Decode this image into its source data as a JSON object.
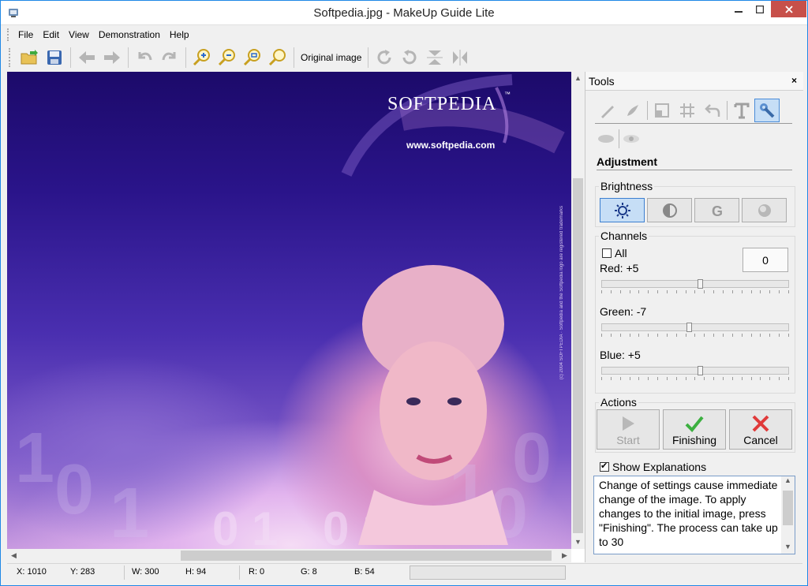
{
  "window": {
    "title": "Softpedia.jpg - MakeUp Guide Lite"
  },
  "menu": [
    "File",
    "Edit",
    "View",
    "Demonstration",
    "Help"
  ],
  "toolbar": {
    "original_image_label": "Original image"
  },
  "image": {
    "logo_text": "SOFTPEDIA",
    "logo_tm": "™",
    "url_text": "www.softpedia.com",
    "side_text": "(c) 2004 SOFTPEDIA · Softpedia and the Softpedia logo are registered trademarks"
  },
  "tools": {
    "title": "Tools",
    "close": "×",
    "section_title": "Adjustment",
    "brightness": {
      "label": "Brightness",
      "selected": "brightness"
    },
    "channels": {
      "label": "Channels",
      "all_label": "All",
      "all_checked": false,
      "value": "0",
      "red_label": "Red: +5",
      "green_label": "Green: -7",
      "blue_label": "Blue: +5",
      "red_value": 5,
      "green_value": -7,
      "blue_value": 5
    },
    "actions": {
      "label": "Actions",
      "start": "Start",
      "finishing": "Finishing",
      "cancel": "Cancel"
    },
    "show_explanations_label": "Show Explanations",
    "show_explanations_checked": true,
    "explanation_text": "Change of settings cause immediate change of the image. To apply changes to the initial image, press \"Finishing\". The process can take up to 30"
  },
  "status": {
    "x": "X: 1010",
    "y": "Y: 283",
    "w": "W: 300",
    "h": "H: 94",
    "r": "R: 0",
    "g": "G: 8",
    "b": "B: 54"
  },
  "colors": {
    "accent": "#1f88e6",
    "close_button": "#c7504a",
    "active_tool": "#c6def6"
  }
}
